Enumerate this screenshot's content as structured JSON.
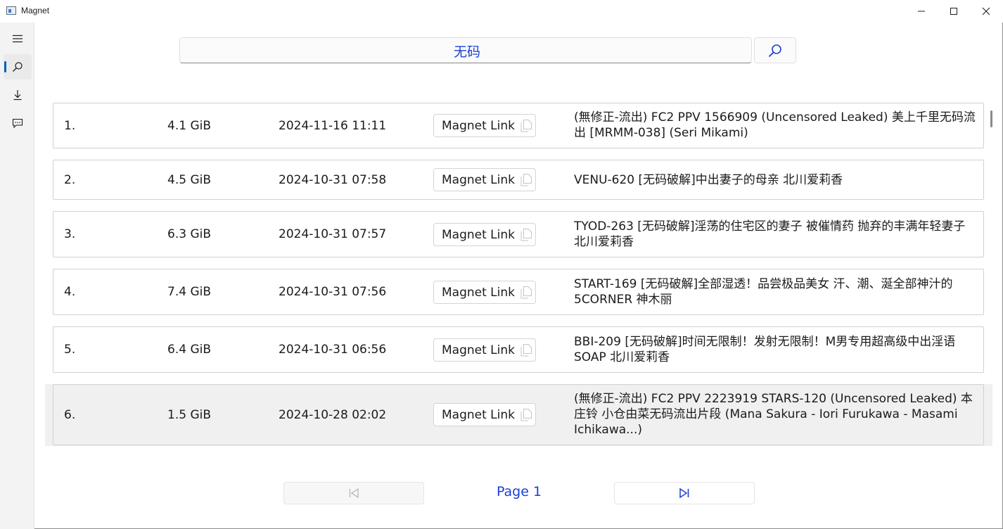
{
  "window": {
    "title": "Magnet"
  },
  "rail": {
    "items": [
      {
        "icon": "hamburger-menu-icon"
      },
      {
        "icon": "search-icon",
        "active": true
      },
      {
        "icon": "download-icon"
      },
      {
        "icon": "feedback-icon"
      }
    ]
  },
  "search": {
    "query": "无码"
  },
  "results": [
    {
      "index": "1.",
      "size": "4.1 GiB",
      "date": "2024-11-16 11:11",
      "button": "Magnet Link",
      "title": "(無修正-流出) FC2 PPV 1566909 (Uncensored Leaked)  美上千里无码流出 [MRMM-038] (Seri Mikami)"
    },
    {
      "index": "2.",
      "size": "4.5 GiB",
      "date": "2024-10-31 07:58",
      "button": "Magnet Link",
      "title": "VENU-620 [无码破解]中出妻子的母亲 北川爱莉香"
    },
    {
      "index": "3.",
      "size": "6.3 GiB",
      "date": "2024-10-31 07:57",
      "button": "Magnet Link",
      "title": "TYOD-263 [无码破解]淫荡的住宅区的妻子 被催情药 抛弃的丰满年轻妻子 北川爱莉香"
    },
    {
      "index": "4.",
      "size": "7.4 GiB",
      "date": "2024-10-31 07:56",
      "button": "Magnet Link",
      "title": "START-169 [无码破解]全部湿透！品尝极品美女 汗、潮、涎全部神汁的5CORNER 神木丽"
    },
    {
      "index": "5.",
      "size": "6.4 GiB",
      "date": "2024-10-31 06:56",
      "button": "Magnet Link",
      "title": "BBI-209 [无码破解]时间无限制！发射无限制！M男专用超高级中出淫语SOAP 北川爱莉香"
    },
    {
      "index": "6.",
      "size": "1.5 GiB",
      "date": "2024-10-28 02:02",
      "button": "Magnet Link",
      "title": "(無修正-流出)  FC2 PPV 2223919  STARS-120 (Uncensored Leaked) 本庄铃 小仓由菜无码流出片段 (Mana Sakura - Iori Furukawa - Masami Ichikawa...)"
    }
  ],
  "pagination": {
    "page_label": "Page 1"
  }
}
